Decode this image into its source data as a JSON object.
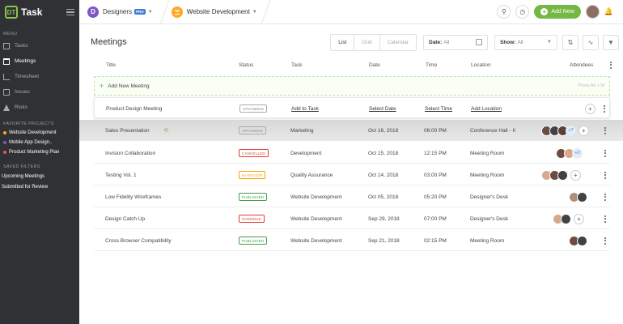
{
  "app": {
    "logo_short": "DT",
    "name": "Task"
  },
  "sidebar": {
    "menu_label": "MENU",
    "items": [
      {
        "label": "Tasks",
        "icon": "tasks-icon",
        "active": false
      },
      {
        "label": "Meetings",
        "icon": "calendar-icon",
        "active": true
      },
      {
        "label": "Timesheet",
        "icon": "timesheet-icon",
        "active": false
      },
      {
        "label": "Issues",
        "icon": "issues-icon",
        "active": false
      },
      {
        "label": "Risks",
        "icon": "warning-icon",
        "active": false
      }
    ],
    "favorites_label": "FAVORITE PROJECTS",
    "favorites": [
      {
        "label": "Website Development",
        "color": "#ffa726"
      },
      {
        "label": "Mobile App Design..",
        "color": "#7e57c2"
      },
      {
        "label": "Product Marketing Plan",
        "color": "#ef5350"
      }
    ],
    "filters_label": "SAVED FILTERS",
    "filters": [
      {
        "label": "Upcoming Meetings"
      },
      {
        "label": "Submitted for Review"
      }
    ]
  },
  "topbar": {
    "workspace_initial": "D",
    "workspace_name": "Designers",
    "pro_badge": "PRO",
    "project_name": "Website Development",
    "add_new_label": "Add New"
  },
  "main": {
    "title": "Meetings",
    "views": [
      "List",
      "Grid",
      "Calendar"
    ],
    "date_label": "Date:",
    "date_value": "All",
    "show_label": "Show:",
    "show_value": "All",
    "columns": [
      "Title",
      "Status",
      "Task",
      "Date",
      "Time",
      "Location",
      "Attendees"
    ],
    "add_meeting_label": "Add New Meeting",
    "add_meeting_hint": "Press Alt + M",
    "new_row": {
      "title": "Product Design Meeting",
      "status": "UPCOMING",
      "task": "Add to Task",
      "date": "Select Date",
      "time": "Select Time",
      "location": "Add Location"
    },
    "rows": [
      {
        "title": "Sales Presentation",
        "status": "UPCOMING",
        "status_class": "st-upcoming",
        "task": "Marketing",
        "date": "Oct 16, 2018",
        "time": "06:00 PM",
        "location": "Conference Hall - II",
        "attendees": 3,
        "more": "+7"
      },
      {
        "title": "Invision Collaboration",
        "status": "CANCELLED",
        "status_class": "st-cancelled",
        "task": "Development",
        "date": "Oct 15, 2018",
        "time": "12:15 PM",
        "location": "Meeting Room",
        "attendees": 2,
        "more": "+2"
      },
      {
        "title": "Testing Vol. 1",
        "status": "IN REVIEW",
        "status_class": "st-inreview",
        "task": "Quality Assurance",
        "date": "Oct 14, 2018",
        "time": "03:00 PM",
        "location": "Meeting Room",
        "attendees": 3,
        "more": ""
      },
      {
        "title": "Low Fidelity Wireframes",
        "status": "PUBLISHED",
        "status_class": "st-published",
        "task": "Website Development",
        "date": "Oct 05, 2018",
        "time": "05:20 PM",
        "location": "Designer's Desk",
        "attendees": 2,
        "more": ""
      },
      {
        "title": "Design Catch Up",
        "status": "OVERDUE",
        "status_class": "st-overdue",
        "task": "Website Development",
        "date": "Sep 29, 2018",
        "time": "07:00 PM",
        "location": "Designer's Desk",
        "attendees": 3,
        "more": ""
      },
      {
        "title": "Cross Browser Compatibility",
        "status": "PUBLISHED",
        "status_class": "st-published",
        "task": "Website Development",
        "date": "Sep 21, 2018",
        "time": "02:15 PM",
        "location": "Meeting Room",
        "attendees": 2,
        "more": ""
      }
    ]
  }
}
